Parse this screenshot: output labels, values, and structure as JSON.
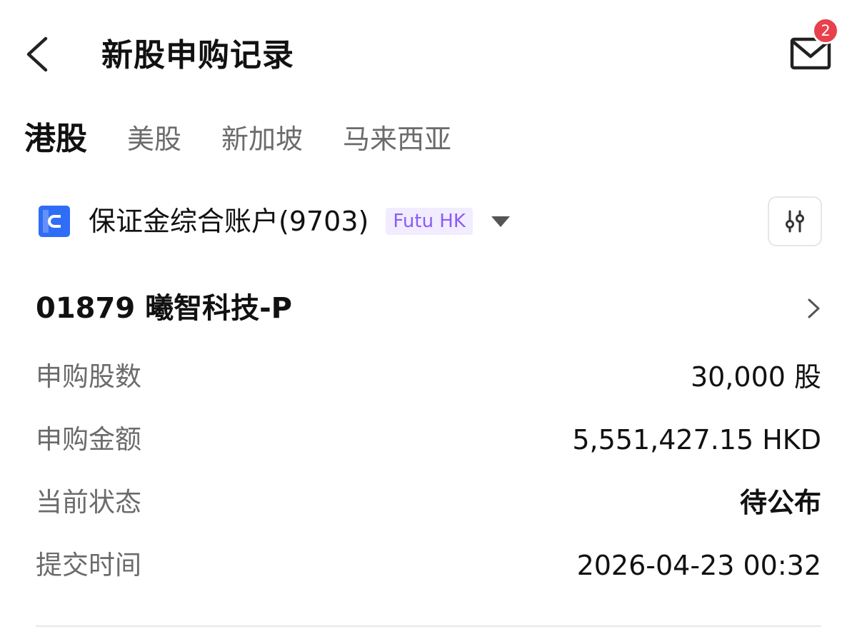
{
  "header": {
    "title": "新股申购记录",
    "back_icon": "chevron-left-icon",
    "mail_icon": "mail-icon",
    "unread_count": "2"
  },
  "tabs": [
    {
      "label": "港股",
      "active": true
    },
    {
      "label": "美股",
      "active": false
    },
    {
      "label": "新加坡",
      "active": false
    },
    {
      "label": "马来西亚",
      "active": false
    }
  ],
  "account": {
    "icon": "account-card-icon",
    "name": "保证金综合账户(9703)",
    "broker": "Futu HK",
    "dropdown_icon": "caret-down-icon",
    "filter_icon": "sliders-icon"
  },
  "record": {
    "stock_title": "01879 曦智科技-P",
    "rows": [
      {
        "label": "申购股数",
        "value": "30,000 股"
      },
      {
        "label": "申购金额",
        "value": "5,551,427.15 HKD"
      },
      {
        "label": "当前状态",
        "value": "待公布"
      },
      {
        "label": "提交时间",
        "value": "2026-04-23 00:32"
      }
    ]
  },
  "colors": {
    "accent_orange": "#ff7a22",
    "badge_red": "#e8414c",
    "account_blue": "#2f6df6",
    "broker_purple": "#8b5cf6",
    "broker_bg": "#f1ecff"
  }
}
